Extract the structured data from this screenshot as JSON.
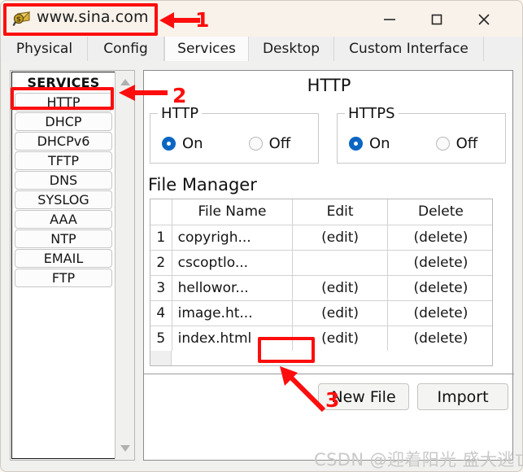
{
  "window": {
    "title": "www.sina.com",
    "icon": "server-search-icon",
    "controls": {
      "minimize": "minimize-icon",
      "maximize": "maximize-icon",
      "close": "close-icon"
    }
  },
  "tabs": [
    {
      "label": "Physical",
      "active": false
    },
    {
      "label": "Config",
      "active": false
    },
    {
      "label": "Services",
      "active": true
    },
    {
      "label": "Desktop",
      "active": false
    },
    {
      "label": "Custom Interface",
      "active": false
    }
  ],
  "sidebar": {
    "heading": "SERVICES",
    "items": [
      {
        "label": "HTTP",
        "selected": true
      },
      {
        "label": "DHCP",
        "selected": false
      },
      {
        "label": "DHCPv6",
        "selected": false
      },
      {
        "label": "TFTP",
        "selected": false
      },
      {
        "label": "DNS",
        "selected": false
      },
      {
        "label": "SYSLOG",
        "selected": false
      },
      {
        "label": "AAA",
        "selected": false
      },
      {
        "label": "NTP",
        "selected": false
      },
      {
        "label": "EMAIL",
        "selected": false
      },
      {
        "label": "FTP",
        "selected": false
      }
    ],
    "scrollbar": {
      "up": "chevron-up-icon",
      "down": "chevron-down-icon"
    }
  },
  "content": {
    "title": "HTTP",
    "http_group": {
      "legend": "HTTP",
      "on_label": "On",
      "off_label": "Off",
      "selected": "On"
    },
    "https_group": {
      "legend": "HTTPS",
      "on_label": "On",
      "off_label": "Off",
      "selected": "On"
    },
    "file_manager": {
      "title": "File Manager",
      "columns": [
        "",
        "File Name",
        "Edit",
        "Delete"
      ],
      "rows": [
        {
          "index": "1",
          "file_name": "copyrigh...",
          "edit": "(edit)",
          "delete": "(delete)"
        },
        {
          "index": "2",
          "file_name": "cscoptlo...",
          "edit": "",
          "delete": "(delete)"
        },
        {
          "index": "3",
          "file_name": "hellowor...",
          "edit": "(edit)",
          "delete": "(delete)"
        },
        {
          "index": "4",
          "file_name": "image.ht...",
          "edit": "(edit)",
          "delete": "(delete)"
        },
        {
          "index": "5",
          "file_name": "index.html",
          "edit": "(edit)",
          "delete": "(delete)"
        }
      ]
    },
    "buttons": {
      "new_file": "New File",
      "import": "Import"
    }
  },
  "annotations": {
    "marker_1": "1",
    "marker_2": "2",
    "marker_3": "3",
    "color": "#fd0d0d"
  },
  "watermark": "CSDN @迎着阳光 盛大逃亡"
}
